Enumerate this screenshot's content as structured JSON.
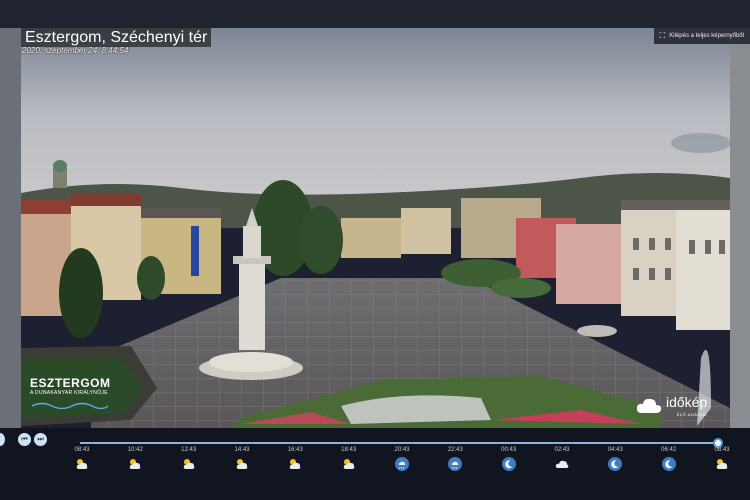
{
  "header": {
    "title": "Esztergom, Széchenyi tér",
    "subtitle": "2020. szeptember 24. 8:44:54"
  },
  "fullscreen": {
    "label": "Kilépés a teljes képernyőből"
  },
  "logos": {
    "left_big": "ESZTERGOM",
    "left_small": "A DUNAKANYAR KIRÁLYNŐJE",
    "right_name": "időkép",
    "right_sub": "ÉLŐ ADÁSOK"
  },
  "colors": {
    "accent": "#4f9be0",
    "night_icon": "#3e7cc2",
    "day_icon_sun": "#f2c230"
  },
  "timeline": {
    "progress": 0.995,
    "ticks": [
      {
        "time": "08:43",
        "icon": "partly-cloudy-day"
      },
      {
        "time": "10:42",
        "icon": "partly-cloudy-day"
      },
      {
        "time": "12:43",
        "icon": "partly-cloudy-day"
      },
      {
        "time": "14:43",
        "icon": "partly-cloudy-day"
      },
      {
        "time": "16:43",
        "icon": "partly-cloudy-day"
      },
      {
        "time": "18:43",
        "icon": "partly-cloudy-day"
      },
      {
        "time": "20:43",
        "icon": "rain-night"
      },
      {
        "time": "22:43",
        "icon": "rain-night"
      },
      {
        "time": "00:43",
        "icon": "clear-night"
      },
      {
        "time": "02:43",
        "icon": "cloudy"
      },
      {
        "time": "04:43",
        "icon": "clear-night"
      },
      {
        "time": "06:42",
        "icon": "clear-night"
      },
      {
        "time": "08:43",
        "icon": "partly-cloudy-day"
      }
    ]
  }
}
